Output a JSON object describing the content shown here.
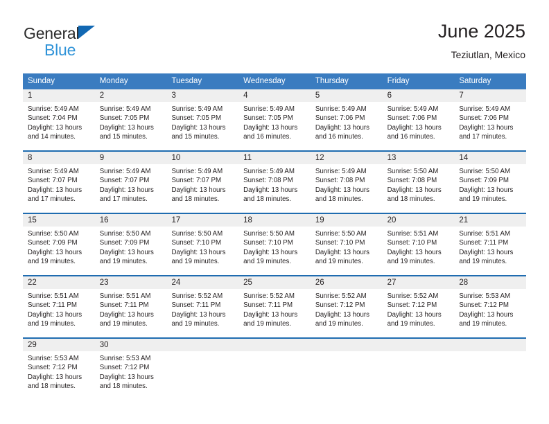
{
  "brand": {
    "name_part1": "General",
    "name_part2": "Blue",
    "triangle_color": "#1268b3",
    "blue_color": "#2f93d8"
  },
  "header": {
    "title": "June 2025",
    "subtitle": "Teziutlan, Mexico"
  },
  "theme": {
    "header_row_bg": "#3a7cc0",
    "week_divider": "#1f6cb0",
    "daynum_band_bg": "#efefef",
    "text_color": "#231f20"
  },
  "calendar": {
    "weekday_headers": [
      "Sunday",
      "Monday",
      "Tuesday",
      "Wednesday",
      "Thursday",
      "Friday",
      "Saturday"
    ],
    "weeks": [
      [
        {
          "day": "1",
          "sunrise": "Sunrise: 5:49 AM",
          "sunset": "Sunset: 7:04 PM",
          "daylight": "Daylight: 13 hours and 14 minutes."
        },
        {
          "day": "2",
          "sunrise": "Sunrise: 5:49 AM",
          "sunset": "Sunset: 7:05 PM",
          "daylight": "Daylight: 13 hours and 15 minutes."
        },
        {
          "day": "3",
          "sunrise": "Sunrise: 5:49 AM",
          "sunset": "Sunset: 7:05 PM",
          "daylight": "Daylight: 13 hours and 15 minutes."
        },
        {
          "day": "4",
          "sunrise": "Sunrise: 5:49 AM",
          "sunset": "Sunset: 7:05 PM",
          "daylight": "Daylight: 13 hours and 16 minutes."
        },
        {
          "day": "5",
          "sunrise": "Sunrise: 5:49 AM",
          "sunset": "Sunset: 7:06 PM",
          "daylight": "Daylight: 13 hours and 16 minutes."
        },
        {
          "day": "6",
          "sunrise": "Sunrise: 5:49 AM",
          "sunset": "Sunset: 7:06 PM",
          "daylight": "Daylight: 13 hours and 16 minutes."
        },
        {
          "day": "7",
          "sunrise": "Sunrise: 5:49 AM",
          "sunset": "Sunset: 7:06 PM",
          "daylight": "Daylight: 13 hours and 17 minutes."
        }
      ],
      [
        {
          "day": "8",
          "sunrise": "Sunrise: 5:49 AM",
          "sunset": "Sunset: 7:07 PM",
          "daylight": "Daylight: 13 hours and 17 minutes."
        },
        {
          "day": "9",
          "sunrise": "Sunrise: 5:49 AM",
          "sunset": "Sunset: 7:07 PM",
          "daylight": "Daylight: 13 hours and 17 minutes."
        },
        {
          "day": "10",
          "sunrise": "Sunrise: 5:49 AM",
          "sunset": "Sunset: 7:07 PM",
          "daylight": "Daylight: 13 hours and 18 minutes."
        },
        {
          "day": "11",
          "sunrise": "Sunrise: 5:49 AM",
          "sunset": "Sunset: 7:08 PM",
          "daylight": "Daylight: 13 hours and 18 minutes."
        },
        {
          "day": "12",
          "sunrise": "Sunrise: 5:49 AM",
          "sunset": "Sunset: 7:08 PM",
          "daylight": "Daylight: 13 hours and 18 minutes."
        },
        {
          "day": "13",
          "sunrise": "Sunrise: 5:50 AM",
          "sunset": "Sunset: 7:08 PM",
          "daylight": "Daylight: 13 hours and 18 minutes."
        },
        {
          "day": "14",
          "sunrise": "Sunrise: 5:50 AM",
          "sunset": "Sunset: 7:09 PM",
          "daylight": "Daylight: 13 hours and 19 minutes."
        }
      ],
      [
        {
          "day": "15",
          "sunrise": "Sunrise: 5:50 AM",
          "sunset": "Sunset: 7:09 PM",
          "daylight": "Daylight: 13 hours and 19 minutes."
        },
        {
          "day": "16",
          "sunrise": "Sunrise: 5:50 AM",
          "sunset": "Sunset: 7:09 PM",
          "daylight": "Daylight: 13 hours and 19 minutes."
        },
        {
          "day": "17",
          "sunrise": "Sunrise: 5:50 AM",
          "sunset": "Sunset: 7:10 PM",
          "daylight": "Daylight: 13 hours and 19 minutes."
        },
        {
          "day": "18",
          "sunrise": "Sunrise: 5:50 AM",
          "sunset": "Sunset: 7:10 PM",
          "daylight": "Daylight: 13 hours and 19 minutes."
        },
        {
          "day": "19",
          "sunrise": "Sunrise: 5:50 AM",
          "sunset": "Sunset: 7:10 PM",
          "daylight": "Daylight: 13 hours and 19 minutes."
        },
        {
          "day": "20",
          "sunrise": "Sunrise: 5:51 AM",
          "sunset": "Sunset: 7:10 PM",
          "daylight": "Daylight: 13 hours and 19 minutes."
        },
        {
          "day": "21",
          "sunrise": "Sunrise: 5:51 AM",
          "sunset": "Sunset: 7:11 PM",
          "daylight": "Daylight: 13 hours and 19 minutes."
        }
      ],
      [
        {
          "day": "22",
          "sunrise": "Sunrise: 5:51 AM",
          "sunset": "Sunset: 7:11 PM",
          "daylight": "Daylight: 13 hours and 19 minutes."
        },
        {
          "day": "23",
          "sunrise": "Sunrise: 5:51 AM",
          "sunset": "Sunset: 7:11 PM",
          "daylight": "Daylight: 13 hours and 19 minutes."
        },
        {
          "day": "24",
          "sunrise": "Sunrise: 5:52 AM",
          "sunset": "Sunset: 7:11 PM",
          "daylight": "Daylight: 13 hours and 19 minutes."
        },
        {
          "day": "25",
          "sunrise": "Sunrise: 5:52 AM",
          "sunset": "Sunset: 7:11 PM",
          "daylight": "Daylight: 13 hours and 19 minutes."
        },
        {
          "day": "26",
          "sunrise": "Sunrise: 5:52 AM",
          "sunset": "Sunset: 7:12 PM",
          "daylight": "Daylight: 13 hours and 19 minutes."
        },
        {
          "day": "27",
          "sunrise": "Sunrise: 5:52 AM",
          "sunset": "Sunset: 7:12 PM",
          "daylight": "Daylight: 13 hours and 19 minutes."
        },
        {
          "day": "28",
          "sunrise": "Sunrise: 5:53 AM",
          "sunset": "Sunset: 7:12 PM",
          "daylight": "Daylight: 13 hours and 19 minutes."
        }
      ],
      [
        {
          "day": "29",
          "sunrise": "Sunrise: 5:53 AM",
          "sunset": "Sunset: 7:12 PM",
          "daylight": "Daylight: 13 hours and 18 minutes."
        },
        {
          "day": "30",
          "sunrise": "Sunrise: 5:53 AM",
          "sunset": "Sunset: 7:12 PM",
          "daylight": "Daylight: 13 hours and 18 minutes."
        },
        {
          "day": "",
          "sunrise": "",
          "sunset": "",
          "daylight": ""
        },
        {
          "day": "",
          "sunrise": "",
          "sunset": "",
          "daylight": ""
        },
        {
          "day": "",
          "sunrise": "",
          "sunset": "",
          "daylight": ""
        },
        {
          "day": "",
          "sunrise": "",
          "sunset": "",
          "daylight": ""
        },
        {
          "day": "",
          "sunrise": "",
          "sunset": "",
          "daylight": ""
        }
      ]
    ]
  }
}
